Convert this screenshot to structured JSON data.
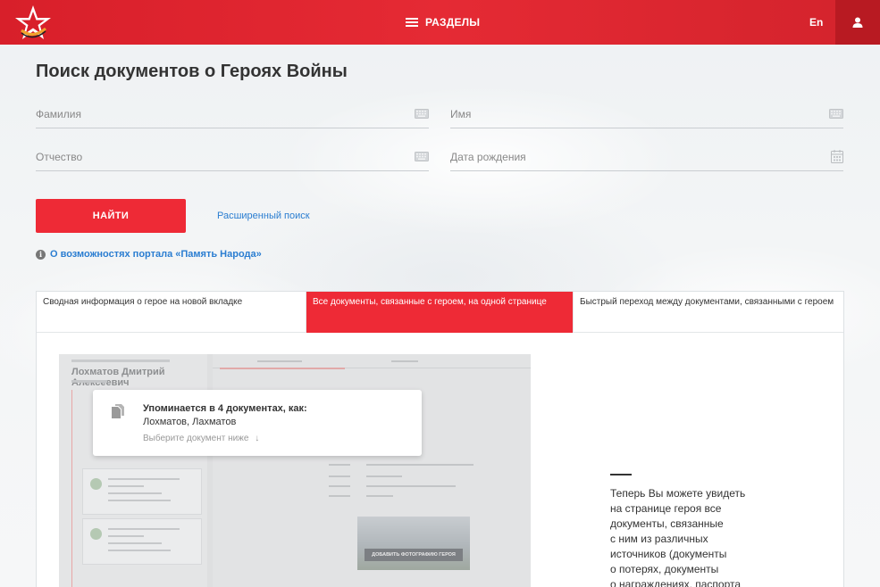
{
  "header": {
    "menu_label": "РАЗДЕЛЫ",
    "lang_label": "En",
    "colors": {
      "primary": "#e52a34",
      "user_bg": "#b81a22",
      "link": "#2a7dd1"
    }
  },
  "search": {
    "title": "Поиск документов о Героях Войны",
    "fields": {
      "surname": "Фамилия",
      "name": "Имя",
      "patronymic": "Отчество",
      "birth_date": "Дата рождения"
    },
    "find_button": "НАЙТИ",
    "advanced_link": "Расширенный поиск",
    "about_link": "О возможностях портала «Память Народа»"
  },
  "tabs": [
    {
      "label": "Сводная информация о герое на новой вкладке",
      "active": false
    },
    {
      "label": "Все документы, связанные с героем, на одной странице",
      "active": true
    },
    {
      "label": "Быстрый переход между документами, связанными с героем",
      "active": false
    }
  ],
  "preview": {
    "hero_name": "Лохматов Дмитрий Алексеевич",
    "popup_title": "Упоминается в 4 документах, как:",
    "popup_names": "Лохматов, Лахматов",
    "popup_hint": "Выберите документ ниже",
    "photo_button": "ДОБАВИТЬ ФОТОГРАФИЮ ГЕРОЯ"
  },
  "description": {
    "lines": [
      "Теперь Вы можете увидеть",
      "на странице героя все",
      "документы, связанные",
      "с ним из различных",
      "источников (документы",
      "о потерях, документы",
      "о награждениях, паспорта"
    ]
  }
}
